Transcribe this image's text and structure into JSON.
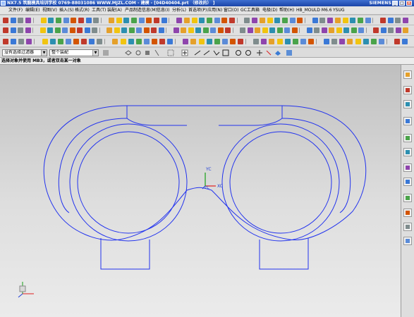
{
  "window": {
    "title": "NX7.5  筑龍模具培训学校  0769-88031086  WWW.MJZL.COM - 建模 - [04D40404.prt （修改的） ]",
    "brand": "SIEMENS",
    "controls": [
      "_",
      "□",
      "×"
    ]
  },
  "menu": {
    "items": [
      "文件(F)",
      "编辑(E)",
      "视图(V)",
      "插入(S)",
      "格式(R)",
      "工具(T)",
      "装配(A)",
      "产品制造信息(M)",
      "信息(I)",
      "分析(L)",
      "首选项(P)",
      "应用(N)",
      "窗口(O)",
      "GC工具箱",
      "电极(D)",
      "帮助(H)",
      "HB_MOULD M6.6",
      "YSUG"
    ]
  },
  "selection": {
    "filter": "没有选择过滤器",
    "scope": "整个装配"
  },
  "cue": "选择对象并使用 MB3，或者双击某一对象",
  "wcs": {
    "x_label": "XC",
    "y_label": "YC"
  },
  "colors": {
    "geometry": "#2233ee",
    "wcs_x": "#e02020",
    "wcs_y": "#16a016",
    "wcs_z": "#1f3fd8"
  }
}
